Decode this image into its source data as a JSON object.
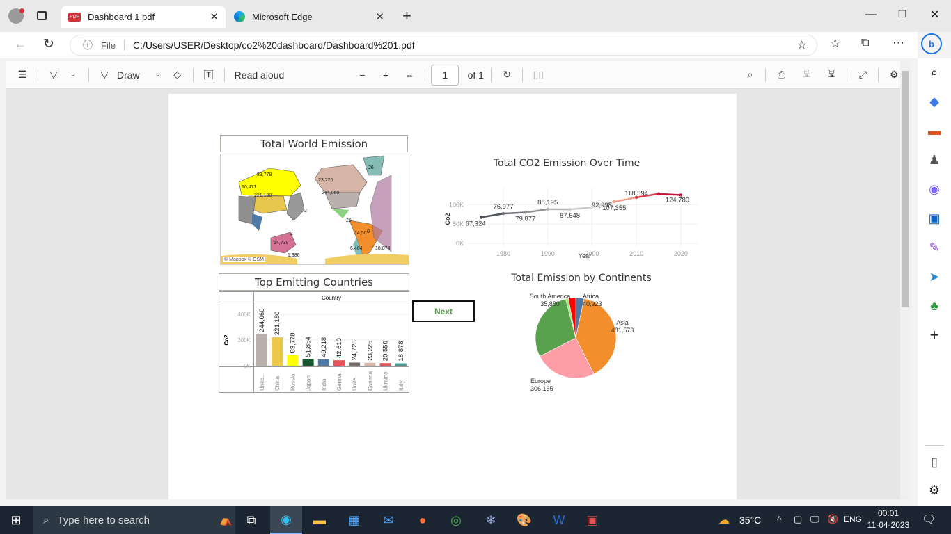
{
  "browser": {
    "tabs": [
      {
        "title": "Dashboard 1.pdf",
        "icon": "pdf-icon"
      },
      {
        "title": "Microsoft Edge",
        "icon": "edge-icon"
      }
    ],
    "url_prefix": "File",
    "url": "C:/Users/USER/Desktop/co2%20dashboard/Dashboard%201.pdf"
  },
  "pdf_toolbar": {
    "draw": "Draw",
    "read_aloud": "Read aloud",
    "page": "1",
    "page_of": "of 1"
  },
  "dashboard": {
    "map": {
      "title": "Total World Emission",
      "attribution": "© Mapbox © OSM",
      "labels": [
        "83,778",
        "23,226",
        "221,180",
        "244,060",
        "14,739",
        "14,50",
        "6,484",
        "26",
        "10,471",
        "1,386",
        "18,874",
        "25",
        "2",
        "4",
        "0"
      ]
    },
    "next_button": "Next"
  },
  "chart_data": [
    {
      "type": "line",
      "title": "Total CO2 Emission Over Time",
      "xlabel": "Year",
      "ylabel": "Co2",
      "x": [
        1975,
        1980,
        1985,
        1990,
        1995,
        2000,
        2005,
        2010,
        2015,
        2020
      ],
      "values": [
        67324,
        76977,
        79877,
        88195,
        87648,
        92998,
        107355,
        118594,
        128000,
        124780
      ],
      "labels": [
        "67,324",
        "76,977",
        "79,877",
        "88,195",
        "87,648",
        "92,998",
        "107,355",
        "118,594",
        null,
        "124,780"
      ],
      "colors": [
        "#4f555b",
        "#707478",
        "#8f9295",
        "#b4b4b4",
        "#c8c8c8",
        "#dddddd",
        "#f4a08c",
        "#d9384a",
        "#c3183c",
        "#c3183c"
      ],
      "xticks": [
        "1980",
        "1990",
        "2000",
        "2010",
        "2020"
      ],
      "yticks": [
        "0K",
        "50K",
        "100K"
      ],
      "ylim": [
        0,
        140000
      ],
      "xlim": [
        1972,
        2023
      ]
    },
    {
      "type": "bar",
      "title": "Top Emitting Countries",
      "header": "Country",
      "ylabel": "Co2",
      "categories": [
        "Unite..",
        "China",
        "Russia",
        "Japan",
        "India",
        "Germa..",
        "Unite..",
        "Canada",
        "Ukraine",
        "Italy"
      ],
      "values": [
        244060,
        221180,
        83778,
        51854,
        49218,
        42610,
        24728,
        23226,
        20550,
        18878
      ],
      "labels": [
        "244,060",
        "221,180",
        "83,778",
        "51,854",
        "49,218",
        "42,610",
        "24,728",
        "23,226",
        "20,550",
        "18,878"
      ],
      "colors": [
        "#bab0ac",
        "#edc948",
        "#ffff00",
        "#17562e",
        "#4e79a7",
        "#e15759",
        "#79706e",
        "#d7b5a6",
        "#e15759",
        "#499894"
      ],
      "yticks": [
        "0K",
        "200K",
        "400K"
      ],
      "ylim": [
        0,
        400000
      ]
    },
    {
      "type": "pie",
      "title": "Total Emission by Continents",
      "slices": [
        {
          "name": "Africa",
          "value": 40923,
          "label": "40,923",
          "color": "#4e79a7"
        },
        {
          "name": "Asia",
          "value": 481573,
          "label": "481,573",
          "color": "#f28e2b"
        },
        {
          "name": "Europe",
          "value": 306165,
          "label": "306,165",
          "color": "#ff9da7"
        },
        {
          "name": null,
          "value": 350000,
          "label": null,
          "color": "#59a14f"
        },
        {
          "name": null,
          "value": 14000,
          "label": null,
          "color": "#a0e57a"
        },
        {
          "name": "South America",
          "value": 35880,
          "label": "35,880",
          "color": "#ff0000"
        }
      ]
    }
  ],
  "taskbar": {
    "search_placeholder": "Type here to search",
    "weather": "35°C",
    "lang": "ENG",
    "time": "00:01",
    "date": "11-04-2023"
  }
}
